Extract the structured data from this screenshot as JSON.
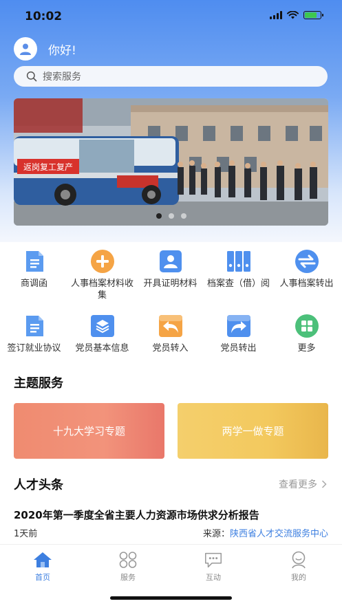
{
  "status_bar": {
    "time": "10:02"
  },
  "header": {
    "greeting": "你好!",
    "search_placeholder": "搜索服务"
  },
  "banner": {
    "slide_count": 3,
    "active_index": 0,
    "sign_text": "返岗复工复产"
  },
  "services": [
    {
      "label": "商调函",
      "icon": "document-icon"
    },
    {
      "label": "人事档案材料收集",
      "icon": "plus-circle-icon"
    },
    {
      "label": "开具证明材料",
      "icon": "user-card-icon"
    },
    {
      "label": "档案查（借）阅",
      "icon": "files-icon"
    },
    {
      "label": "人事档案转出",
      "icon": "transfer-icon"
    },
    {
      "label": "签订就业协议",
      "icon": "document-icon"
    },
    {
      "label": "党员基本信息",
      "icon": "layers-icon"
    },
    {
      "label": "党员转入",
      "icon": "reply-icon"
    },
    {
      "label": "党员转出",
      "icon": "forward-icon"
    },
    {
      "label": "更多",
      "icon": "grid-icon"
    }
  ],
  "theme_section": {
    "title": "主题服务",
    "cards": [
      {
        "label": "十九大学习专题"
      },
      {
        "label": "两学一做专题"
      }
    ]
  },
  "news_section": {
    "title": "人才头条",
    "more_label": "查看更多",
    "item": {
      "title": "2020年第一季度全省主要人力资源市场供求分析报告",
      "time": "1天前",
      "source_label": "来源：",
      "source": "陕西省人才交流服务中心"
    }
  },
  "tabbar": [
    {
      "label": "首页",
      "icon": "home-icon",
      "active": true
    },
    {
      "label": "服务",
      "icon": "services-icon",
      "active": false
    },
    {
      "label": "互动",
      "icon": "chat-icon",
      "active": false
    },
    {
      "label": "我的",
      "icon": "profile-icon",
      "active": false
    }
  ],
  "colors": {
    "primary": "#3d7fe0",
    "card_red": "#ef8b70",
    "card_yellow": "#f4cf6c"
  }
}
